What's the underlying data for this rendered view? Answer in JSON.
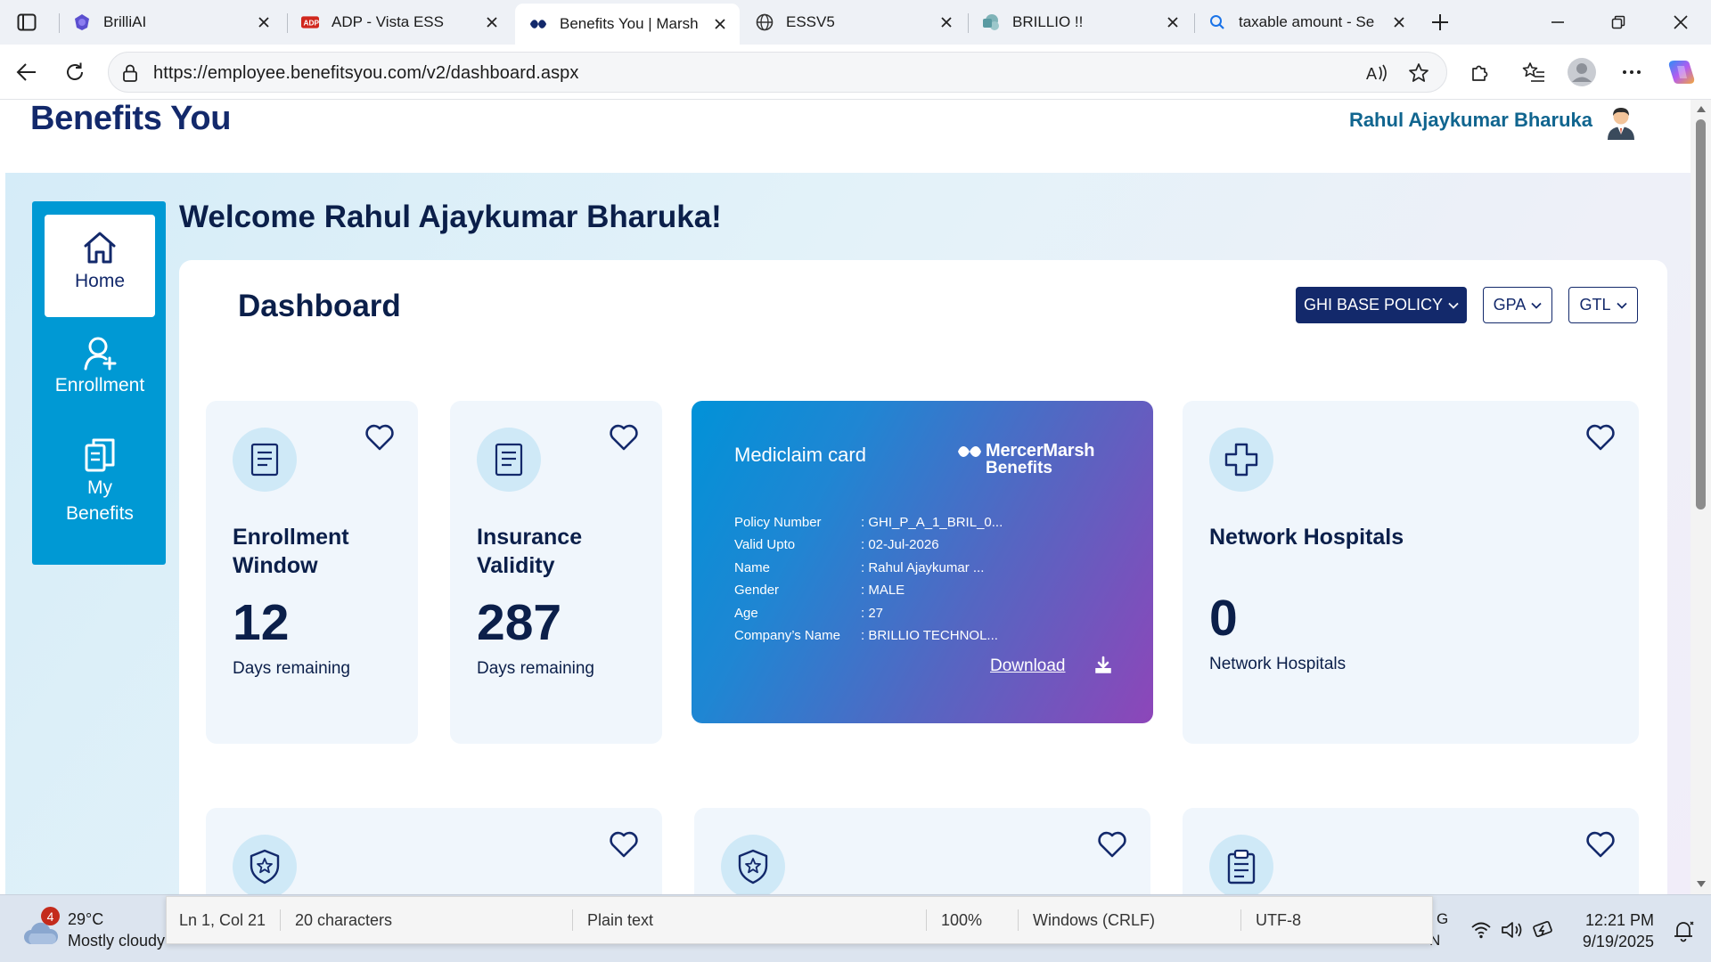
{
  "browser": {
    "tabs": [
      {
        "title": "BrilliAI",
        "icon": "brilliai-icon"
      },
      {
        "title": "ADP - Vista ESS",
        "icon": "adp-icon"
      },
      {
        "title": "Benefits You | Marsh",
        "icon": "marsh-icon"
      },
      {
        "title": "ESSV5",
        "icon": "globe-icon"
      },
      {
        "title": "BRILLIO !!",
        "icon": "sharepoint-icon"
      },
      {
        "title": "taxable amount - Se",
        "icon": "search-icon"
      }
    ],
    "active_tab_index": 2,
    "url": "https://employee.benefitsyou.com/v2/dashboard.aspx"
  },
  "site": {
    "brand": "Benefits You",
    "user_name": "Rahul Ajaykumar Bharuka",
    "colors": {
      "brand": "#13296b",
      "nav": "#0099d4",
      "user": "#10658f"
    }
  },
  "nav": {
    "items": [
      {
        "label": "Home",
        "icon": "home-icon",
        "active": true
      },
      {
        "label": "Enrollment",
        "icon": "user-add-icon",
        "active": false
      },
      {
        "label": "My Benefits",
        "icon": "documents-icon",
        "active": false
      }
    ]
  },
  "main": {
    "welcome": "Welcome Rahul Ajaykumar Bharuka!",
    "dashboard_title": "Dashboard",
    "policy_buttons": [
      {
        "label": "GHI BASE POLICY",
        "selected": true
      },
      {
        "label": "GPA",
        "selected": false
      },
      {
        "label": "GTL",
        "selected": false
      }
    ],
    "cards": {
      "enrollment": {
        "title_line1": "Enrollment",
        "title_line2": "Window",
        "value": "12",
        "subtitle": "Days remaining"
      },
      "insurance": {
        "title_line1": "Insurance",
        "title_line2": "Validity",
        "value": "287",
        "subtitle": "Days remaining"
      },
      "hospitals": {
        "title": "Network Hospitals",
        "value": "0",
        "subtitle": "Network Hospitals"
      }
    },
    "mediclaim": {
      "title": "Mediclaim card",
      "logo_line1": "MercerMarsh",
      "logo_line2": "Benefits",
      "fields": [
        {
          "label": "Policy Number",
          "value": ": GHI_P_A_1_BRIL_0..."
        },
        {
          "label": "Valid Upto",
          "value": ": 02-Jul-2026"
        },
        {
          "label": "Name",
          "value": ": Rahul Ajaykumar ..."
        },
        {
          "label": "Gender",
          "value": ": MALE"
        },
        {
          "label": "Age",
          "value": ": 27"
        },
        {
          "label": "Company’s Name",
          "value": ": BRILLIO TECHNOL..."
        }
      ],
      "download_label": "Download"
    }
  },
  "taskbar": {
    "weather_temp": "29°C",
    "weather_desc": "Mostly cloudy",
    "weather_badge": "4",
    "lang_line1": "G",
    "lang_line2": "N",
    "time": "12:21 PM",
    "date": "9/19/2025"
  },
  "notepad_status": {
    "position": "Ln 1, Col 21",
    "chars": "20 characters",
    "format": "Plain text",
    "zoom": "100%",
    "line_endings": "Windows (CRLF)",
    "encoding": "UTF-8"
  }
}
